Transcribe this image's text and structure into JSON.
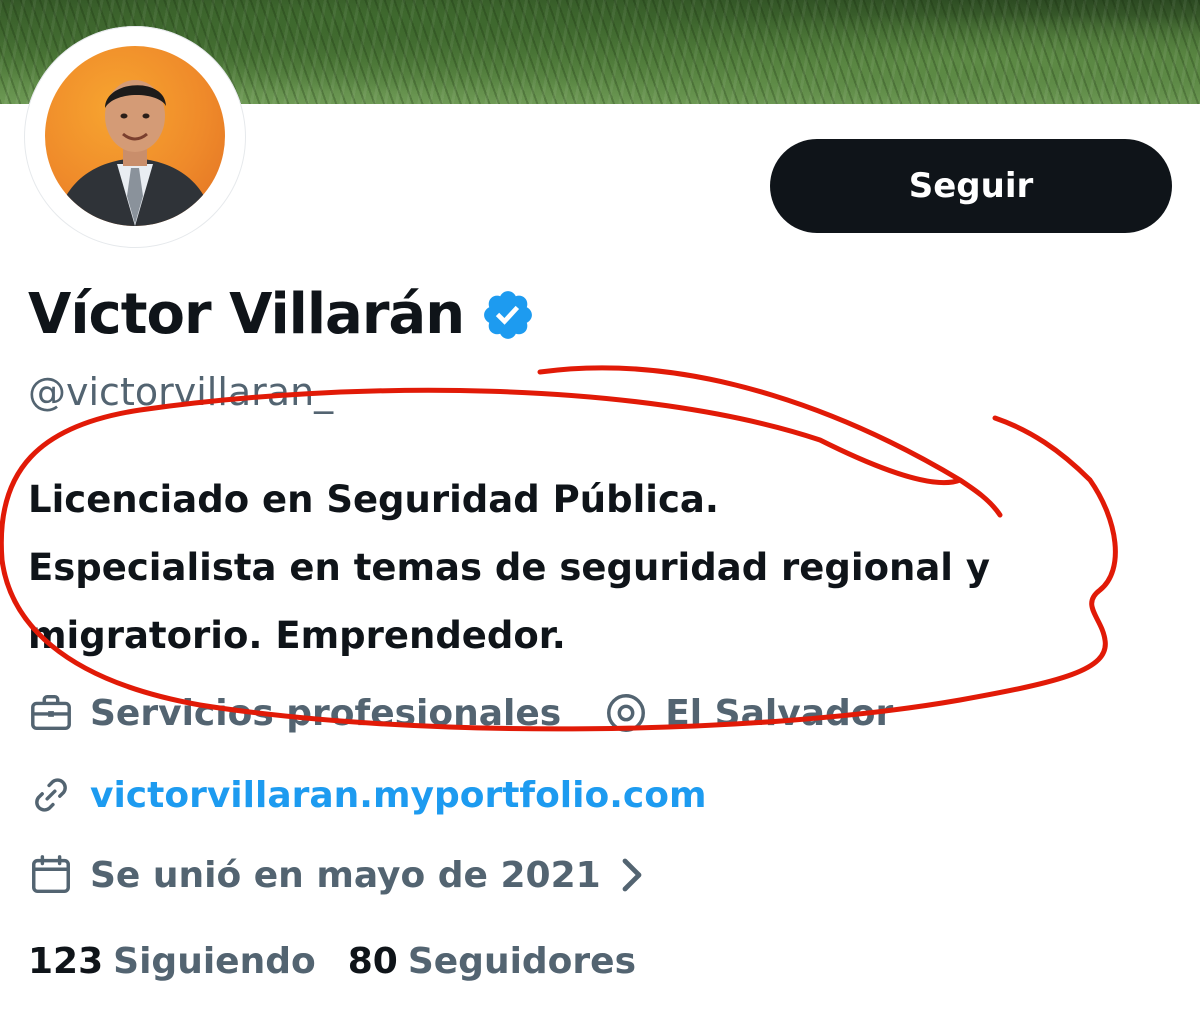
{
  "profile": {
    "display_name": "Víctor Villarán",
    "handle": "@victorvillaran_",
    "verified_icon": "verified-badge-icon",
    "follow_label": "Seguir",
    "bio_lines": [
      "Licenciado en Seguridad Pública.",
      "Especialista en temas de seguridad regional y",
      "migratorio. Emprendedor."
    ],
    "category": "Servicios profesionales",
    "location": "El Salvador",
    "website": "victorvillaran.myportfolio.com",
    "joined": "Se unió en mayo de 2021",
    "following_count": "123",
    "following_label": "Siguiendo",
    "followers_count": "80",
    "followers_label": "Seguidores"
  },
  "colors": {
    "text_primary": "#0f1419",
    "text_secondary": "#536471",
    "link": "#1d9bf0",
    "verified": "#1d9bf0",
    "annotation": "#e11a07",
    "avatar_bg": "#ef8a2a"
  },
  "icons": {
    "category": "briefcase-icon",
    "location": "location-pin-icon",
    "website": "link-icon",
    "joined": "calendar-icon",
    "joined_more": "chevron-right-icon"
  }
}
